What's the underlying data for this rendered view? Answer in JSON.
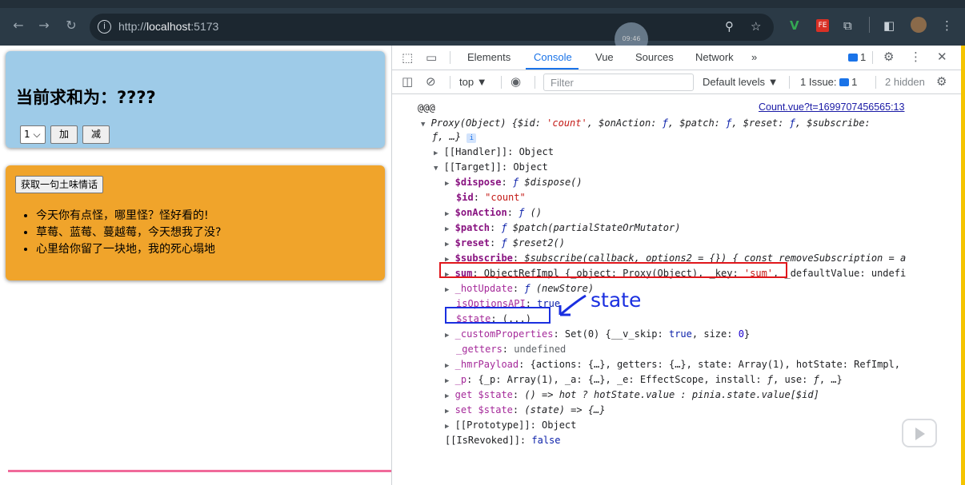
{
  "browser": {
    "url_prefix": "http://",
    "url_host": "localhost",
    "url_port": ":5173",
    "clock_text": "09:46",
    "icons": [
      "back-arrow-icon",
      "forward-arrow-icon",
      "reload-icon",
      "info-icon",
      "zoom-icon",
      "star-icon",
      "extension-v-icon",
      "extension-fe-icon",
      "puzzle-icon",
      "sidepanel-icon",
      "avatar",
      "kebab-menu-icon"
    ]
  },
  "app": {
    "sum_title": "当前求和为：????",
    "select_value": "1",
    "add_label": "加",
    "minus_label": "减",
    "fetch_label": "获取一句土味情话",
    "talks": [
      "今天你有点怪，哪里怪？怪好看的!",
      "草莓、蓝莓、蔓越莓，今天想我了没?",
      "心里给你留了一块地，我的死心塌地"
    ]
  },
  "devtools": {
    "tabs": [
      "Elements",
      "Console",
      "Vue",
      "Sources",
      "Network"
    ],
    "active_tab": "Console",
    "more_tabs": "»",
    "issues_badge": "1",
    "context": "top",
    "filter_placeholder": "Filter",
    "levels": "Default levels ▼",
    "issues_text": "1 Issue:",
    "issues_count": "1",
    "hidden_text": "2 hidden",
    "log_label": "@@@",
    "source_link": "Count.vue?t=1699707456565:13",
    "annotation": "state",
    "colors": {
      "accent": "#1a73e8",
      "annot_red": "#e0161b",
      "annot_blue": "#1a2fe0"
    }
  }
}
